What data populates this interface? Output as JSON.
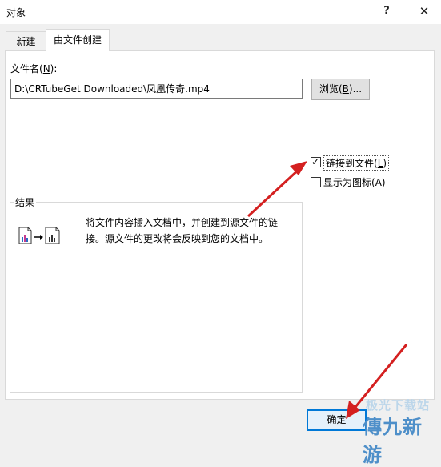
{
  "window": {
    "title": "对象",
    "help_symbol": "?",
    "close_symbol": "✕"
  },
  "tabs": {
    "new_label": "新建",
    "from_file_label": "由文件创建"
  },
  "file": {
    "label_prefix": "文件名(",
    "label_key": "N",
    "label_suffix": "):",
    "value": "D:\\CRTubeGet Downloaded\\凤凰传奇.mp4"
  },
  "browse": {
    "prefix": "浏览(",
    "key": "B",
    "suffix": ")..."
  },
  "options": {
    "link": {
      "prefix": "链接到文件(",
      "key": "L",
      "suffix": ")",
      "checked": true
    },
    "display_icon": {
      "prefix": "显示为图标(",
      "key": "A",
      "suffix": ")",
      "checked": false
    }
  },
  "result": {
    "title": "结果",
    "text": "将文件内容插入文档中，并创建到源文件的链接。源文件的更改将会反映到您的文档中。"
  },
  "ok_button": {
    "prefix": "确",
    "suffix": "定"
  },
  "watermark": {
    "top_text": "极光下载站",
    "main_text": "傳九新游"
  },
  "colors": {
    "accent": "#0078d7",
    "arrow": "#d42020"
  }
}
